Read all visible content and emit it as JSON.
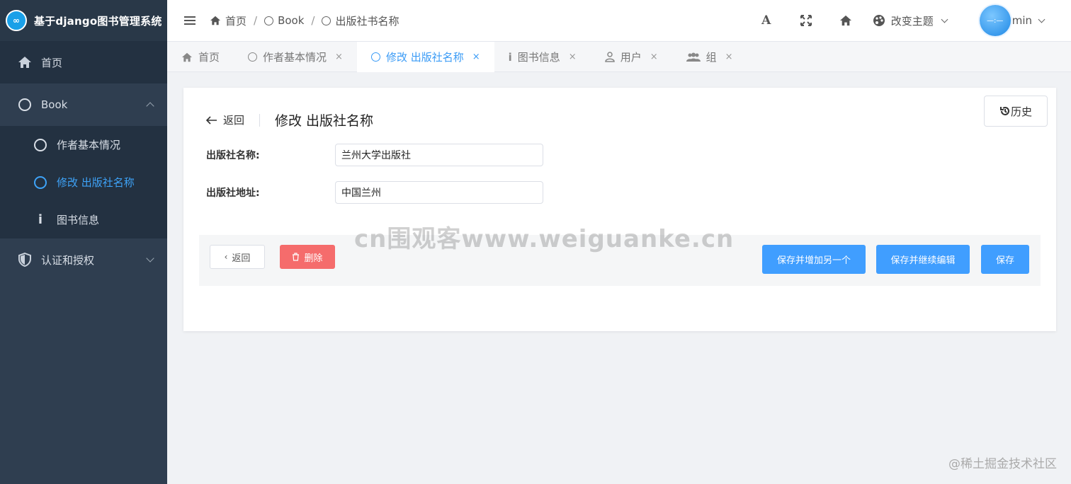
{
  "app": {
    "title": "基于django图书管理系统",
    "logo_text": "∞"
  },
  "sidebar": {
    "items": [
      {
        "label": "首页",
        "icon": "home-icon"
      },
      {
        "label": "Book",
        "icon": "circle-icon"
      },
      {
        "label": "作者基本情况",
        "icon": "circle-icon"
      },
      {
        "label": "修改 出版社名称",
        "icon": "circle-icon"
      },
      {
        "label": "图书信息",
        "icon": "info-icon"
      },
      {
        "label": "认证和授权",
        "icon": "shield-icon"
      }
    ]
  },
  "header": {
    "breadcrumb": [
      "首页",
      "Book",
      "出版社书名称"
    ],
    "separator": "/",
    "font_icon": "A",
    "theme_label": "改变主题",
    "user_name": "min",
    "avatar_text": "—:—"
  },
  "tabs": [
    {
      "label": "首页"
    },
    {
      "label": "作者基本情况",
      "close": "×"
    },
    {
      "label": "修改 出版社名称",
      "close": "×"
    },
    {
      "label": "图书信息",
      "close": "×"
    },
    {
      "label": "用户",
      "close": "×"
    },
    {
      "label": "组",
      "close": "×"
    }
  ],
  "page": {
    "back_label": "返回",
    "title": "修改 出版社名称",
    "history_label": "历史",
    "fields": [
      {
        "label": "出版社名称:",
        "value": "兰州大学出版社"
      },
      {
        "label": "出版社地址:",
        "value": "中国兰州"
      }
    ],
    "actions": {
      "back": "返回",
      "delete": "删除",
      "save_add": "保存并增加另一个",
      "save_continue": "保存并继续编辑",
      "save": "保存"
    }
  },
  "watermark": "cn围观客www.weiguanke.cn",
  "footer_mark": "@稀土掘金技术社区",
  "colors": {
    "accent": "#409eff",
    "danger": "#f56c6c",
    "sidebar": "#2f3e50"
  }
}
